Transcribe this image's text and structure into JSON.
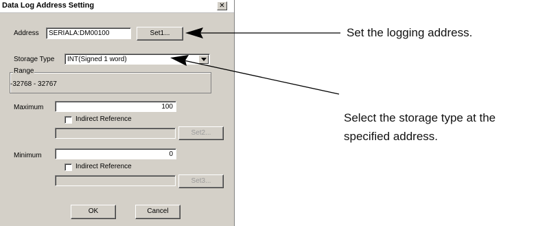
{
  "dialog": {
    "title": "Data Log Address Setting",
    "close_glyph": "✕",
    "address": {
      "label": "Address",
      "value": "SERIALA:DM00100",
      "set_button": "Set1..."
    },
    "storage_type": {
      "label": "Storage Type",
      "value": "INT(Signed 1 word)"
    },
    "range": {
      "label": "Range",
      "value": "-32768 - 32767"
    },
    "maximum": {
      "label": "Maximum",
      "value": "100",
      "indirect_label": "Indirect Reference",
      "indirect_value": "",
      "set_button": "Set2..."
    },
    "minimum": {
      "label": "Minimum",
      "value": "0",
      "indirect_label": "Indirect Reference",
      "indirect_value": "",
      "set_button": "Set3..."
    },
    "ok_button": "OK",
    "cancel_button": "Cancel"
  },
  "annotations": {
    "address_note": "Set the logging address.",
    "storage_note": "Select the storage type at the specified address."
  },
  "icons": [
    "close-icon",
    "dropdown-arrow-icon",
    "callout-arrow-icon"
  ],
  "colors": {
    "dialog_bg": "#d4d0c8",
    "field_bg": "#ffffff",
    "text": "#000000"
  }
}
